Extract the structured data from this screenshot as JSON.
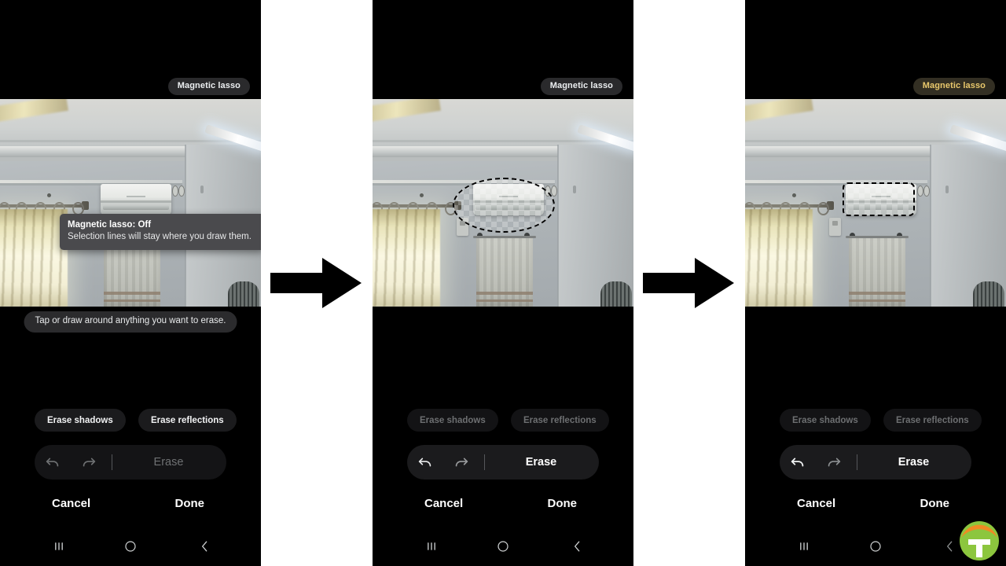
{
  "panels": [
    {
      "id": "panel-1",
      "chip_label": "Magnetic lasso",
      "chip_active": false,
      "tooltip": {
        "title": "Magnetic lasso: Off",
        "body": "Selection lines will stay where you draw them."
      },
      "hint": "Tap or draw around anything you want to erase.",
      "erase_shadows": "Erase shadows",
      "erase_reflections": "Erase reflections",
      "erase_label": "Erase",
      "cancel": "Cancel",
      "done": "Done",
      "selection": "none"
    },
    {
      "id": "panel-2",
      "chip_label": "Magnetic lasso",
      "chip_active": false,
      "hint": "",
      "erase_shadows": "Erase shadows",
      "erase_reflections": "Erase reflections",
      "erase_label": "Erase",
      "cancel": "Cancel",
      "done": "Done",
      "selection": "ellipse"
    },
    {
      "id": "panel-3",
      "chip_label": "Magnetic lasso",
      "chip_active": true,
      "hint": "",
      "erase_shadows": "Erase shadows",
      "erase_reflections": "Erase reflections",
      "erase_label": "Erase",
      "cancel": "Cancel",
      "done": "Done",
      "selection": "rect"
    }
  ],
  "icons": {
    "undo": "undo-icon",
    "redo": "redo-icon",
    "recents": "recents-nav-icon",
    "home": "home-nav-icon",
    "back": "back-nav-icon",
    "arrow": "right-arrow-icon",
    "watermark": "watermark-logo"
  },
  "colors": {
    "chip_active_text": "#e9c86c",
    "chip_active_bg": "#332f23",
    "chip_bg": "#2a2a2c",
    "panel_bg": "#000000",
    "gap_bg": "#ffffff",
    "logo_orange": "#ef8b23",
    "logo_green": "#8cc63e"
  }
}
